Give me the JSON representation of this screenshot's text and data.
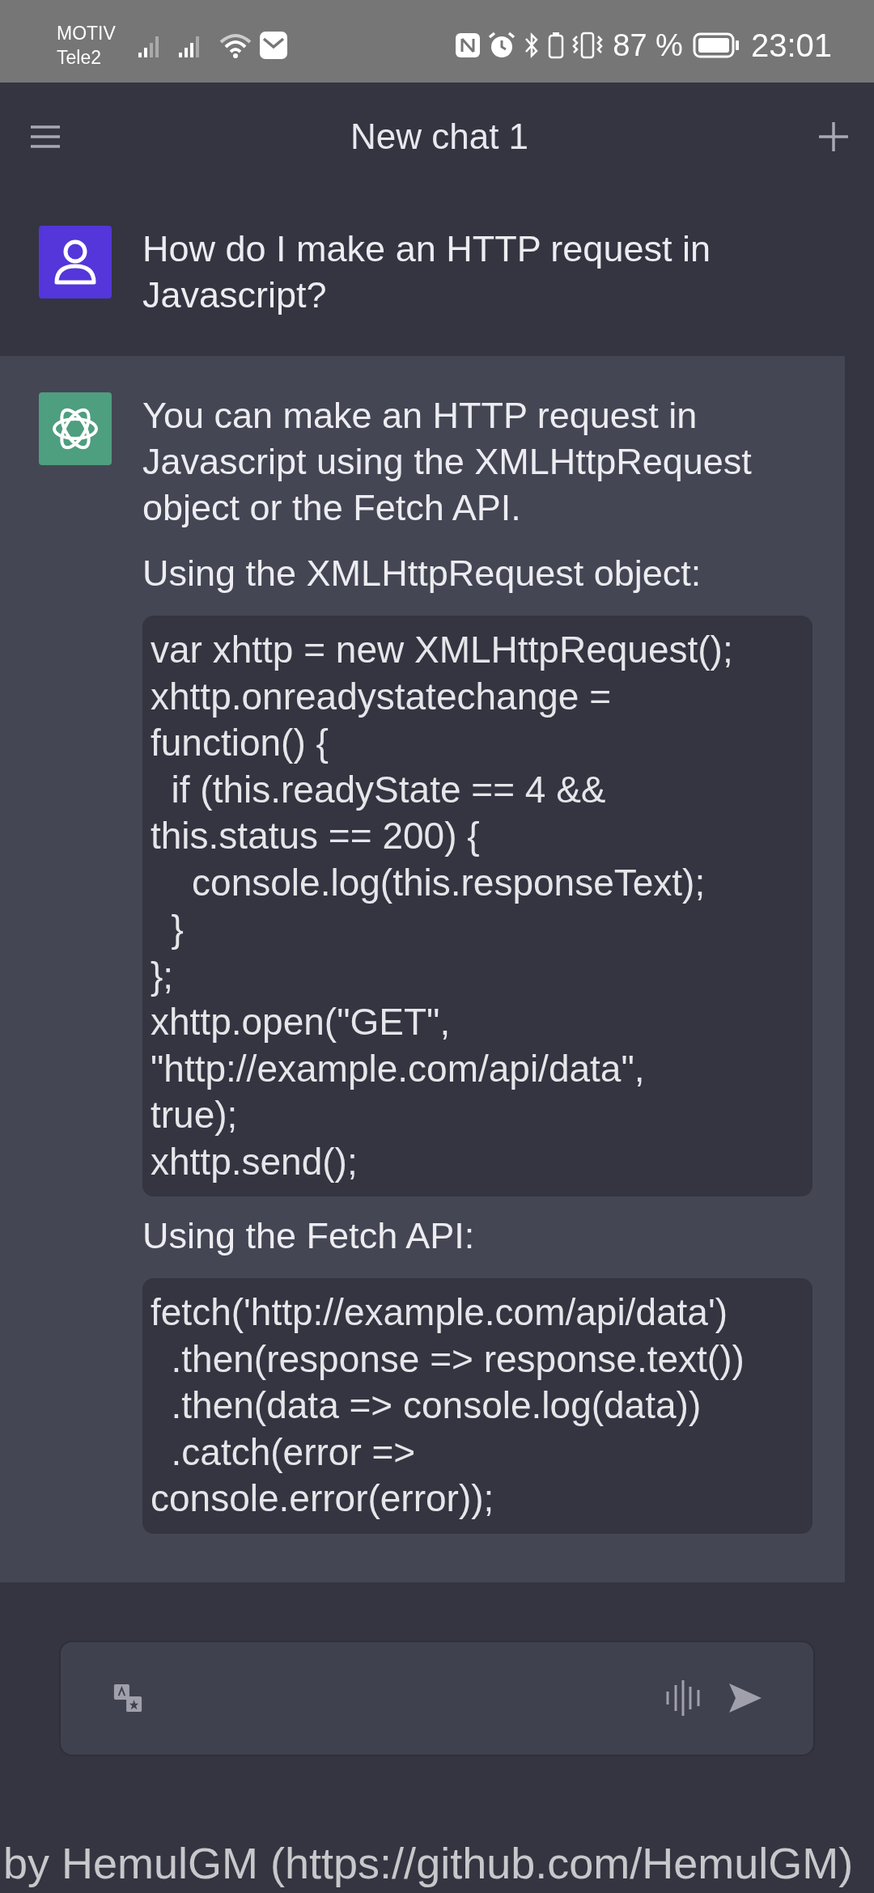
{
  "status_bar": {
    "carrier_1": "MOTIV",
    "carrier_2": "Tele2",
    "battery_percent": "87 %",
    "time": "23:01"
  },
  "header": {
    "title": "New chat 1"
  },
  "messages": [
    {
      "kind": "user",
      "blocks": [
        {
          "kind": "text",
          "text": "How do I make an HTTP request in Javascript?"
        }
      ]
    },
    {
      "kind": "assistant",
      "blocks": [
        {
          "kind": "text",
          "text": "You can make an HTTP request in Javascript using the XMLHttpRequest object or the Fetch API."
        },
        {
          "kind": "text",
          "text": "Using the XMLHttpRequest object:"
        },
        {
          "kind": "code",
          "text": "var xhttp = new XMLHttpRequest();\nxhttp.onreadystatechange =\nfunction() {\n  if (this.readyState == 4 &&\nthis.status == 200) {\n    console.log(this.responseText);\n  }\n};\nxhttp.open(\"GET\",\n\"http://example.com/api/data\",\ntrue);\nxhttp.send();"
        },
        {
          "kind": "text",
          "text": "Using the Fetch API:"
        },
        {
          "kind": "code",
          "text": "fetch('http://example.com/api/data')\n  .then(response => response.text())\n  .then(data => console.log(data))\n  .catch(error =>\nconsole.error(error));"
        }
      ]
    }
  ],
  "caption": "by HemulGM (https://github.com/HemulGM)"
}
